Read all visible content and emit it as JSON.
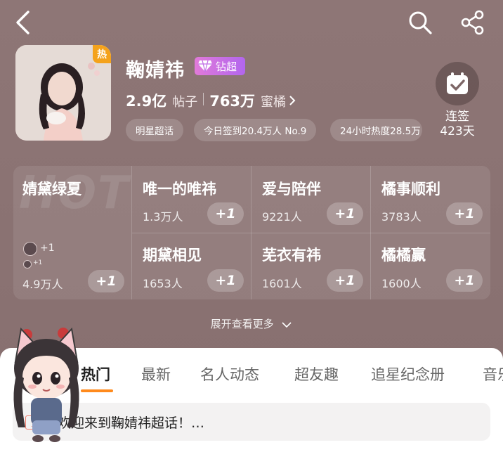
{
  "profile": {
    "name": "鞠婧祎",
    "badge_label": "钻超",
    "hot_tag": "热",
    "posts_count": "2.9亿",
    "posts_unit": "帖子",
    "fans_count": "763万",
    "fans_unit": "蜜橘",
    "chips": [
      "明星超话",
      "今日签到20.4万人 No.9",
      "24小时热度28.5万"
    ],
    "checkin_label_1": "连签",
    "checkin_label_2": "423天"
  },
  "groups": {
    "watermark": "HOT",
    "featured": {
      "title": "婧黛绿夏",
      "count": "4.9万人",
      "avatar_plus": "+1",
      "avatar_plus_small": "+1"
    },
    "plus_label": "+1",
    "items": [
      {
        "title": "唯一的唯祎",
        "count": "1.3万人"
      },
      {
        "title": "爱与陪伴",
        "count": "9221人"
      },
      {
        "title": "橘事顺利",
        "count": "3783人"
      },
      {
        "title": "期黛相见",
        "count": "1653人"
      },
      {
        "title": "芜衣有祎",
        "count": "1601人"
      },
      {
        "title": "橘橘赢",
        "count": "1600人"
      }
    ]
  },
  "expand_label": "展开查看更多",
  "tabs": [
    "热门",
    "最新",
    "名人动态",
    "超友趣",
    "追星纪念册",
    "音乐"
  ],
  "notice": {
    "tag": "置顶",
    "text": "欢迎来到鞠婧祎超话！…"
  },
  "colors": {
    "accent": "#ff8a1c",
    "vip_start": "#e17ad9",
    "vip_end": "#b266ee",
    "hot": "#f4a21c"
  }
}
